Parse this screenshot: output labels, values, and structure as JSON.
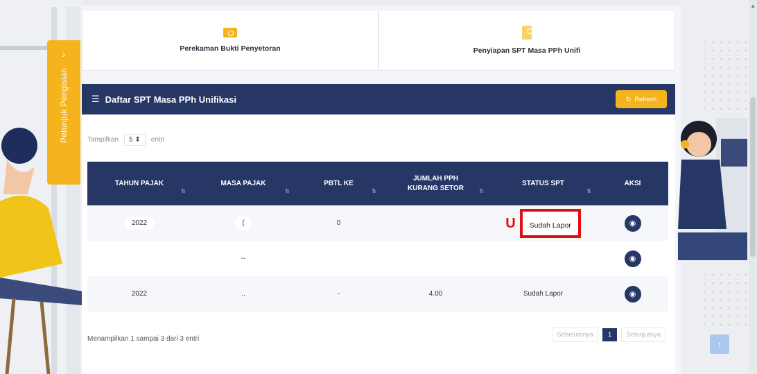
{
  "sidebar_tab": {
    "arrow": "›",
    "label": "Petunjuk Pengisian"
  },
  "cards": [
    {
      "icon": "payment-icon",
      "label": "Perekaman Bukti Penyetoran"
    },
    {
      "icon": "document-icon",
      "label": "Penyiapan SPT Masa PPh Unifi"
    }
  ],
  "panel": {
    "title": "Daftar SPT Masa PPh Unifikasi",
    "refresh_label": "Refresh"
  },
  "show_entries": {
    "prefix": "Tampilkan",
    "value": "5",
    "suffix": "entri"
  },
  "table": {
    "headers": [
      "TAHUN PAJAK",
      "MASA PAJAK",
      "PBTL KE",
      "JUMLAH PPH\nKURANG SETOR",
      "STATUS SPT",
      "AKSI"
    ],
    "rows": [
      {
        "tahun": "2022",
        "masa": "(",
        "pbtl": "0",
        "jumlah": "",
        "status": "Sudah Lapor"
      },
      {
        "tahun": "",
        "masa": "--",
        "pbtl": "",
        "jumlah": "",
        "status": ""
      },
      {
        "tahun": "2022",
        "masa": "..",
        "pbtl": "-",
        "jumlah": "4.00",
        "status": "Sudah Lapor"
      }
    ]
  },
  "footer": {
    "info": "Menampilkan 1 sampai 3 dari 3 entri",
    "prev": "Sebelumnya",
    "page": "1",
    "next": "Selanjutnya"
  },
  "overlay_mark": "U",
  "colors": {
    "navy": "#263766",
    "accent": "#f5b31e",
    "highlight": "#e01010"
  }
}
